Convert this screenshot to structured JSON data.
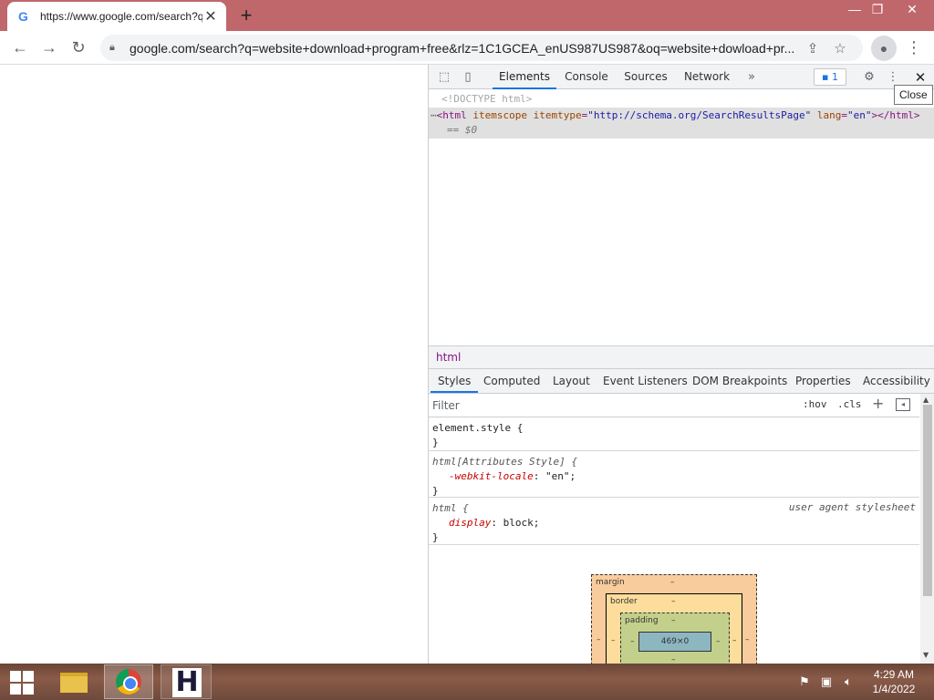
{
  "browser": {
    "tab_title": "https://www.google.com/search?q=website+download",
    "url": "google.com/search?q=website+download+program+free&rlz=1C1GCEA_enUS987US987&oq=website+dowload+pr..."
  },
  "devtools": {
    "tabs": [
      "Elements",
      "Console",
      "Sources",
      "Network"
    ],
    "issues_count": "1",
    "close_tooltip": "Close",
    "dom": {
      "doctype": "<!DOCTYPE html>",
      "html_open": "<html",
      "attr1": "itemscope",
      "attr2_name": "itemtype",
      "attr2_value": "\"http://schema.org/SearchResultsPage\"",
      "attr3_name": "lang",
      "attr3_value": "\"en\"",
      "html_close": "></html>",
      "selected_marker": "== $0"
    },
    "breadcrumb": "html",
    "subtabs": [
      "Styles",
      "Computed",
      "Layout",
      "Event Listeners",
      "DOM Breakpoints",
      "Properties",
      "Accessibility"
    ],
    "filter_placeholder": "Filter",
    "hov_label": ":hov",
    "cls_label": ".cls",
    "rules": {
      "element_style": "element.style {",
      "close_brace": "}",
      "attr_selector": "html[Attributes Style] {",
      "attr_prop_name": "-webkit-locale",
      "attr_prop_value": ": \"en\";",
      "html_selector": "html {",
      "html_origin": "user agent stylesheet",
      "html_prop_name": "display",
      "html_prop_value": ": block;"
    },
    "box_model": {
      "margin_label": "margin",
      "border_label": "border",
      "padding_label": "padding",
      "dash": "–",
      "content": "469×0"
    }
  },
  "taskbar": {
    "time": "4:29 AM",
    "date": "1/4/2022"
  },
  "colors": {
    "titlebar": "#c0676b",
    "devtools_accent": "#1a73e8"
  }
}
